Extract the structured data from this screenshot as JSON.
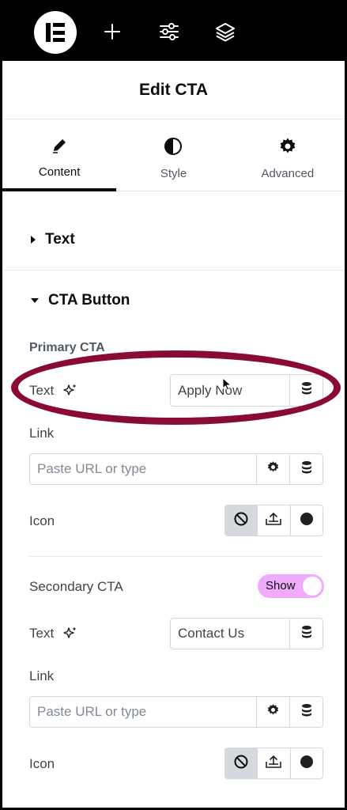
{
  "topbar": {
    "logo": "elementor-logo",
    "icons": [
      "plus-icon",
      "sliders-icon",
      "layers-icon"
    ]
  },
  "header": {
    "title": "Edit CTA"
  },
  "tabs": [
    {
      "label": "Content",
      "icon": "pencil-icon",
      "active": true
    },
    {
      "label": "Style",
      "icon": "half-circle-icon",
      "active": false
    },
    {
      "label": "Advanced",
      "icon": "gear-icon",
      "active": false
    }
  ],
  "sections": {
    "text": {
      "title": "Text",
      "expanded": false
    },
    "cta_button": {
      "title": "CTA Button",
      "expanded": true
    }
  },
  "primary": {
    "heading": "Primary CTA",
    "text_label": "Text",
    "text_value": "Apply Now",
    "link_label": "Link",
    "link_placeholder": "Paste URL or type",
    "icon_label": "Icon"
  },
  "secondary": {
    "heading": "Secondary CTA",
    "toggle_label": "Show",
    "toggle_on": true,
    "text_label": "Text",
    "text_value": "Contact Us",
    "link_label": "Link",
    "link_placeholder": "Paste URL or type",
    "icon_label": "Icon"
  },
  "colors": {
    "highlight": "#8a0a37",
    "toggle": "#f0abfc",
    "topbar": "#000000"
  }
}
